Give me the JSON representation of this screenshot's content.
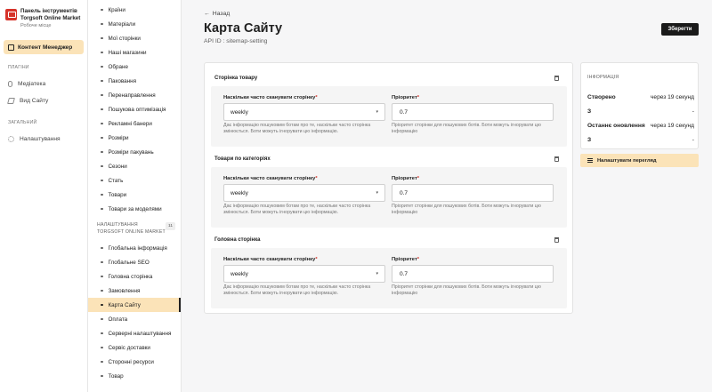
{
  "brand": {
    "title_line1": "Панель інструментів",
    "title_line2": "Torgsoft Online Market",
    "subtitle": "Робоче місце"
  },
  "sidebar": {
    "active": {
      "icon": "house-icon",
      "label": "Контент Менеджер"
    },
    "plugins_title": "ПЛАГІНИ",
    "plugins": [
      {
        "icon": "paperclip-icon",
        "label": "Медіатека"
      },
      {
        "icon": "layers-icon",
        "label": "Вид Сайту"
      }
    ],
    "general_title": "ЗАГАЛЬНИЙ",
    "general": [
      {
        "icon": "gear-icon",
        "label": "Налаштування"
      }
    ]
  },
  "tree": {
    "collections": [
      "Країни",
      "Матеріали",
      "Мої сторінки",
      "Наші магазини",
      "Обране",
      "Паковання",
      "Перенаправлення",
      "Пошукова оптимізація",
      "Рекламні банери",
      "Розміри",
      "Розміри пакувань",
      "Сезони",
      "Стать",
      "Товари",
      "Товари за моделями"
    ],
    "group_line1": "НАЛАШТУВАННЯ",
    "group_line2": "TORGSOFT ONLINE MARKET",
    "group_count": "11",
    "settings": [
      "Глобальна інформація",
      "Глобальне SEO",
      "Головна сторінка",
      "Замовлення",
      "Карта Сайту",
      "Оплата",
      "Серверні налаштування",
      "Сервіс доставки",
      "Сторонні ресурси",
      "Товар"
    ],
    "active_item": "Карта Сайту"
  },
  "main": {
    "back_label": "Назад",
    "title": "Карта Сайту",
    "api_id": "API ID : sitemap-setting",
    "save_label": "Зберегти",
    "sections": [
      {
        "title": "Сторінка товару",
        "freq_label": "Наскільки часто сканувати сторінку",
        "freq_value": "weekly",
        "freq_help": "Дає інформацію пошуковим ботам про те, наскільки часто сторінка змінюється. Боти можуть ігнорувати цю інформацію.",
        "priority_label": "Пріоритет",
        "priority_value": "0.7",
        "priority_help": "Пріоритет сторінки для пошукових ботів. Боти можуть ігнорувати цю інформацію"
      },
      {
        "title": "Товари по категоріях",
        "freq_label": "Наскільки часто сканувати сторінку",
        "freq_value": "weekly",
        "freq_help": "Дає інформацію пошуковим ботам про те, наскільки часто сторінка змінюється. Боти можуть ігнорувати цю інформацію.",
        "priority_label": "Пріоритет",
        "priority_value": "0.7",
        "priority_help": "Пріоритет сторінки для пошукових ботів. Боти можуть ігнорувати цю інформацію"
      },
      {
        "title": "Головна сторінка",
        "freq_label": "Наскільки часто сканувати сторінку",
        "freq_value": "weekly",
        "freq_help": "Дає інформацію пошуковим ботам про те, наскільки часто сторінка змінюється. Боти можуть ігнорувати цю інформацію.",
        "priority_label": "Пріоритет",
        "priority_value": "0.7",
        "priority_help": "Пріоритет сторінки для пошукових ботів. Боти можуть ігнорувати цю інформацію"
      }
    ]
  },
  "info": {
    "title": "ІНФОРМАЦІЯ",
    "rows": [
      {
        "key": "Створено",
        "value": "через 19 секунд"
      },
      {
        "key": "З",
        "value": "-"
      },
      {
        "key": "Останнє оновлення",
        "value": "через 19 секунд"
      },
      {
        "key": "З",
        "value": "-"
      }
    ],
    "customize_label": "Налаштувати перегляд"
  },
  "colors": {
    "accent": "#fbe3b8",
    "required": "#d6332a",
    "primary_button": "#1a1a1a"
  }
}
